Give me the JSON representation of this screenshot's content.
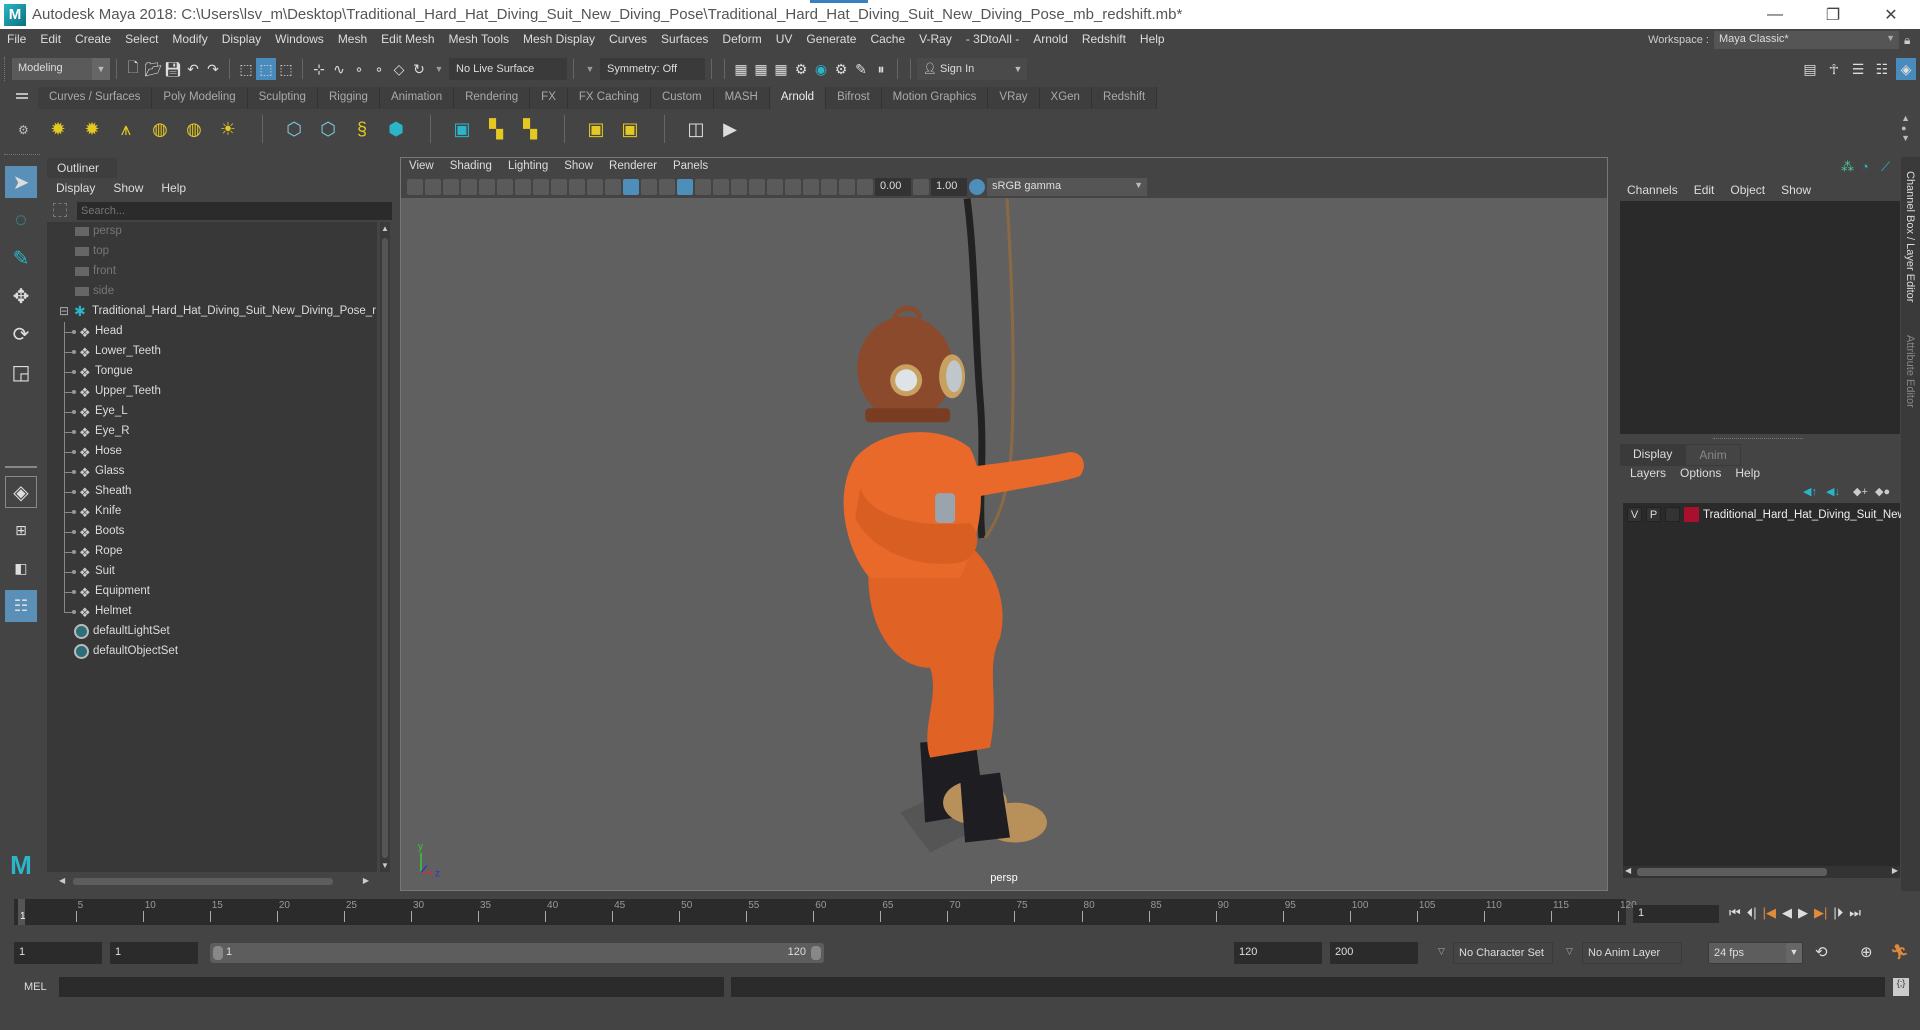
{
  "window": {
    "title": "Autodesk Maya 2018: C:\\Users\\lsv_m\\Desktop\\Traditional_Hard_Hat_Diving_Suit_New_Diving_Pose\\Traditional_Hard_Hat_Diving_Suit_New_Diving_Pose_mb_redshift.mb*",
    "logo": "M",
    "minimize": "—",
    "restore": "❐",
    "close": "✕"
  },
  "menubar": {
    "items": [
      "File",
      "Edit",
      "Create",
      "Select",
      "Modify",
      "Display",
      "Windows",
      "Mesh",
      "Edit Mesh",
      "Mesh Tools",
      "Mesh Display",
      "Curves",
      "Surfaces",
      "Deform",
      "UV",
      "Generate",
      "Cache",
      "V-Ray",
      "- 3DtoAll -",
      "Arnold",
      "Redshift",
      "Help"
    ],
    "workspace_label": "Workspace :",
    "workspace_value": "Maya Classic*"
  },
  "statusline": {
    "mode": "Modeling",
    "live_surface": "No Live Surface",
    "symmetry": "Symmetry: Off",
    "sign_in": "Sign In"
  },
  "shelf": {
    "tabs": [
      "Curves / Surfaces",
      "Poly Modeling",
      "Sculpting",
      "Rigging",
      "Animation",
      "Rendering",
      "FX",
      "FX Caching",
      "Custom",
      "MASH",
      "Arnold",
      "Bifrost",
      "Motion Graphics",
      "VRay",
      "XGen",
      "Redshift"
    ],
    "active_tab": "Arnold"
  },
  "outliner": {
    "title": "Outliner",
    "menu": [
      "Display",
      "Show",
      "Help"
    ],
    "search_placeholder": "Search...",
    "cameras": [
      "persp",
      "top",
      "front",
      "side"
    ],
    "root": "Traditional_Hard_Hat_Diving_Suit_New_Diving_Pose_r",
    "children": [
      "Head",
      "Lower_Teeth",
      "Tongue",
      "Upper_Teeth",
      "Eye_L",
      "Eye_R",
      "Hose",
      "Glass",
      "Sheath",
      "Knife",
      "Boots",
      "Rope",
      "Suit",
      "Equipment",
      "Helmet"
    ],
    "sets": [
      "defaultLightSet",
      "defaultObjectSet"
    ]
  },
  "viewport": {
    "menu": [
      "View",
      "Shading",
      "Lighting",
      "Show",
      "Renderer",
      "Panels"
    ],
    "exposure": "0.00",
    "gamma": "1.00",
    "color_space": "sRGB gamma",
    "camera_label": "persp",
    "axis": {
      "y": "y",
      "x": "x",
      "z": "z"
    }
  },
  "channelbox": {
    "menu": [
      "Channels",
      "Edit",
      "Object",
      "Show"
    ],
    "layer_tabs": [
      "Display",
      "Anim"
    ],
    "layer_menu": [
      "Layers",
      "Options",
      "Help"
    ],
    "layer": {
      "v": "V",
      "p": "P",
      "name": "Traditional_Hard_Hat_Diving_Suit_New",
      "color": "#a8102e"
    },
    "side_tabs": [
      "Channel Box / Layer Editor",
      "Attribute Editor"
    ]
  },
  "timeline": {
    "ticks": [
      "5",
      "10",
      "15",
      "20",
      "25",
      "30",
      "35",
      "40",
      "45",
      "50",
      "55",
      "60",
      "65",
      "70",
      "75",
      "80",
      "85",
      "90",
      "95",
      "100",
      "105",
      "110",
      "115",
      "120"
    ],
    "current_marker": "1",
    "current_frame": "1",
    "start_min": "1",
    "start": "1",
    "range_start": "1",
    "range_end": "120",
    "end": "120",
    "end_max": "200",
    "character_set": "No Character Set",
    "anim_layer": "No Anim Layer",
    "fps": "24 fps"
  },
  "cmdline": {
    "label": "MEL"
  }
}
